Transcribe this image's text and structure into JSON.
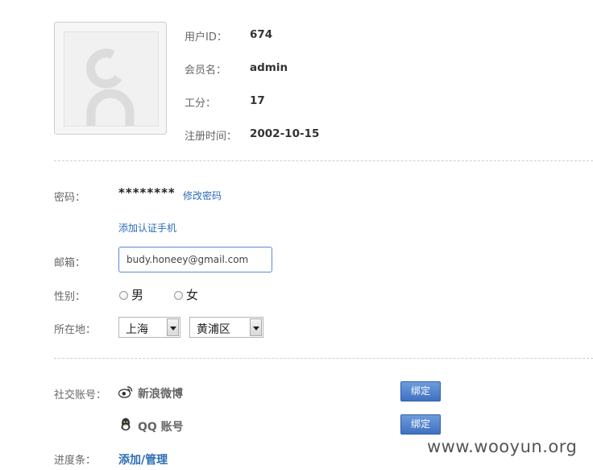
{
  "profile": {
    "user_id_label": "用户ID：",
    "user_id": "674",
    "member_name_label": "会员名：",
    "member_name": "admin",
    "work_points_label": "工分：",
    "work_points": "17",
    "register_time_label": "注册时间：",
    "register_time": "2002-10-15"
  },
  "form": {
    "password_label": "密码：",
    "password_mask": "********",
    "change_password_link": "修改密码",
    "add_phone_link": "添加认证手机",
    "email_label": "邮箱：",
    "email_value": "budy.honeey@gmail.com",
    "gender_label": "性别：",
    "gender_options": [
      "男",
      "女"
    ],
    "location_label": "所在地：",
    "province_value": "上海",
    "district_value": "黄浦区"
  },
  "social": {
    "label": "社交账号：",
    "accounts": [
      {
        "name": "新浪微博",
        "icon": "weibo-icon",
        "button": "绑定"
      },
      {
        "name": "QQ 账号",
        "icon": "qq-icon",
        "button": "绑定"
      }
    ]
  },
  "progress": {
    "label": "进度条：",
    "link": "添加/管理"
  },
  "watermark": "www.wooyun.org",
  "colors": {
    "link": "#2b6cb5",
    "button": "#3f72c2",
    "input_border": "#5b8ad1"
  }
}
